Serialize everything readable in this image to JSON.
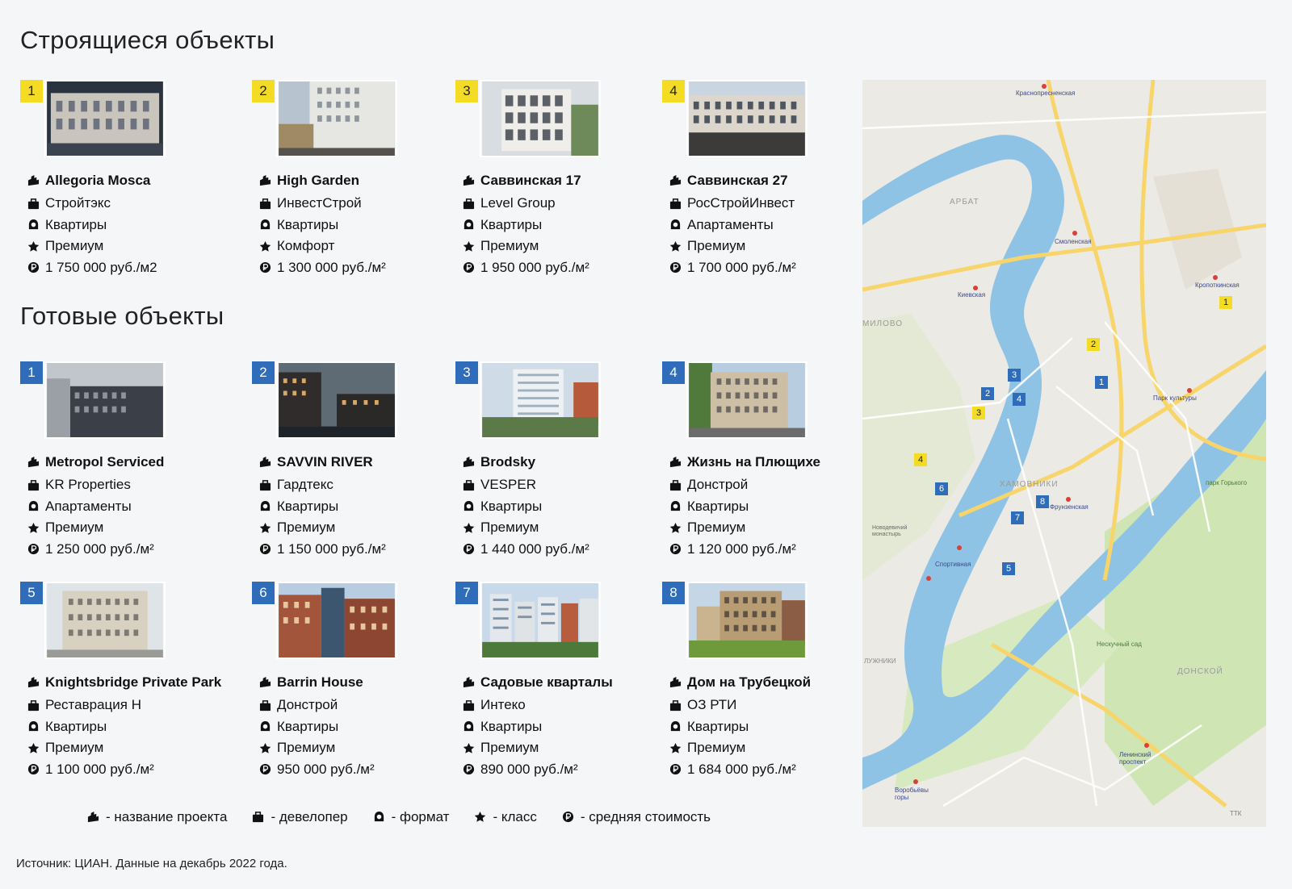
{
  "titles": {
    "building": "Строящиеся объекты",
    "ready": "Готовые объекты"
  },
  "building": [
    {
      "num": "1",
      "name": "Allegoria Mosca",
      "developer": "Стройтэкс",
      "format": "Квартиры",
      "class": "Премиум",
      "price": "1 750 000 руб./м2"
    },
    {
      "num": "2",
      "name": "High Garden",
      "developer": "ИнвестСтрой",
      "format": "Квартиры",
      "class": "Комфорт",
      "price": "1 300 000 руб./м²"
    },
    {
      "num": "3",
      "name": "Саввинская 17",
      "developer": "Level Group",
      "format": "Квартиры",
      "class": "Премиум",
      "price": "1 950 000 руб./м²"
    },
    {
      "num": "4",
      "name": "Саввинская 27",
      "developer": "РосСтройИнвест",
      "format": "Апартаменты",
      "class": "Премиум",
      "price": "1 700 000 руб./м²"
    }
  ],
  "ready": [
    {
      "num": "1",
      "name": "Metropol Serviced",
      "developer": "KR Properties",
      "format": "Апартаменты",
      "class": "Премиум",
      "price": "1 250 000 руб./м²"
    },
    {
      "num": "2",
      "name": "SAVVIN RIVER",
      "developer": "Гардтекс",
      "format": "Квартиры",
      "class": "Премиум",
      "price": "1 150 000 руб./м²"
    },
    {
      "num": "3",
      "name": "Brodsky",
      "developer": "VESPER",
      "format": "Квартиры",
      "class": "Премиум",
      "price": "1 440 000 руб./м²"
    },
    {
      "num": "4",
      "name": "Жизнь на Плющихе",
      "developer": "Донстрой",
      "format": "Квартиры",
      "class": "Премиум",
      "price": "1 120 000 руб./м²"
    },
    {
      "num": "5",
      "name": "Knightsbridge Private Park",
      "developer": "Реставрация Н",
      "format": "Квартиры",
      "class": "Премиум",
      "price": "1 100 000 руб./м²"
    },
    {
      "num": "6",
      "name": "Barrin House",
      "developer": "Донстрой",
      "format": "Квартиры",
      "class": "Премиум",
      "price": "950 000 руб./м²"
    },
    {
      "num": "7",
      "name": "Садовые кварталы",
      "developer": "Интеко",
      "format": "Квартиры",
      "class": "Премиум",
      "price": "890 000 руб./м²"
    },
    {
      "num": "8",
      "name": "Дом на Трубецкой",
      "developer": "ОЗ РТИ",
      "format": "Квартиры",
      "class": "Премиум",
      "price": "1 684 000 руб./м²"
    }
  ],
  "legend": {
    "name": "- название проекта",
    "developer": "- девелопер",
    "format": "- формат",
    "class": "- класс",
    "price": "- средняя стоимость"
  },
  "source": "Источник: ЦИАН. Данные на декабрь 2022 года.",
  "map": {
    "labels": {
      "arbat": "АРБАТ",
      "khamovniki": "ХАМОВНИКИ",
      "donskoy": "ДОНСКОЙ",
      "luzhniki": "ЛУЖНИКИ",
      "gorky_park": "парк Горького",
      "neskuchny": "Нескучный сад",
      "dorogomilovo": "МИЛОВО",
      "smolenskaya": "Смоленская",
      "kievskaya": "Киевская",
      "kropotkinskaya": "Кропоткинская",
      "park_kultury": "Парк культуры",
      "frunzenskaya": "Фрунзенская",
      "sportivnaya": "Спортивная",
      "vorobyovy": "Воробьёвы горы",
      "leninsky": "Ленинский проспект",
      "krasnopresnenskaya": "Краснопресненская",
      "novodevichy": "Новодевичий монастырь",
      "ttk": "ТТК"
    },
    "pins": [
      {
        "type": "yellow",
        "num": "1"
      },
      {
        "type": "yellow",
        "num": "2"
      },
      {
        "type": "yellow",
        "num": "3"
      },
      {
        "type": "yellow",
        "num": "4"
      },
      {
        "type": "blue",
        "num": "1"
      },
      {
        "type": "blue",
        "num": "2"
      },
      {
        "type": "blue",
        "num": "3"
      },
      {
        "type": "blue",
        "num": "4"
      },
      {
        "type": "blue",
        "num": "5"
      },
      {
        "type": "blue",
        "num": "6"
      },
      {
        "type": "blue",
        "num": "7"
      },
      {
        "type": "blue",
        "num": "8"
      }
    ],
    "colors": {
      "water": "#8fc3e6",
      "park": "#cfe6b4",
      "land": "#eceae4",
      "road": "#f7d56a"
    }
  },
  "colors": {
    "badge_building": "#f5dc24",
    "badge_ready": "#2f6dbb"
  }
}
